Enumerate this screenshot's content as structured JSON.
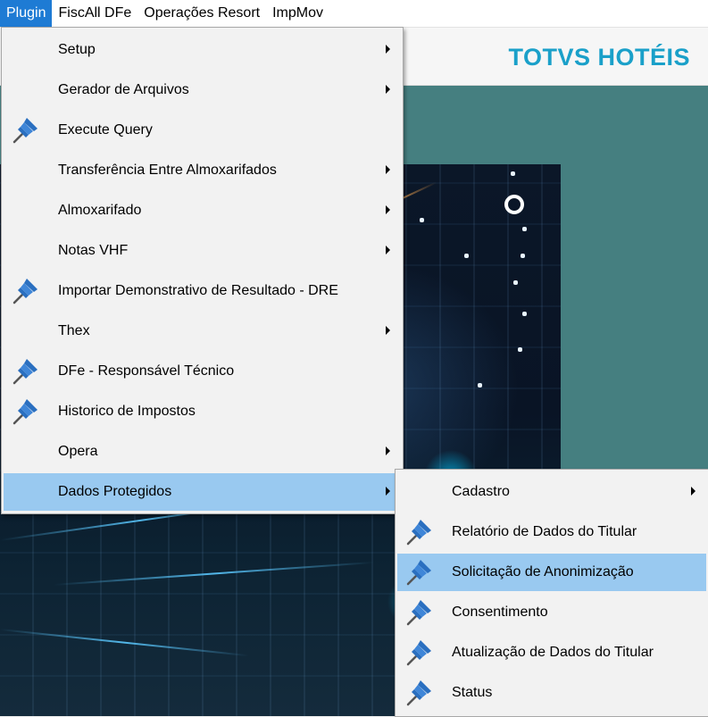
{
  "menubar": {
    "items": [
      {
        "label": "Plugin",
        "active": true
      },
      {
        "label": "FiscAll DFe",
        "active": false
      },
      {
        "label": "Operações Resort",
        "active": false
      },
      {
        "label": "ImpMov",
        "active": false
      }
    ]
  },
  "header": {
    "brand": "TOTVS HOTÉIS"
  },
  "plugin_menu": {
    "items": [
      {
        "label": "Setup",
        "icon": "",
        "submenu": true
      },
      {
        "label": "Gerador de Arquivos",
        "icon": "",
        "submenu": true
      },
      {
        "label": "Execute Query",
        "icon": "pin-icon",
        "submenu": false
      },
      {
        "label": "Transferência Entre Almoxarifados",
        "icon": "",
        "submenu": true
      },
      {
        "label": "Almoxarifado",
        "icon": "",
        "submenu": true
      },
      {
        "label": "Notas VHF",
        "icon": "",
        "submenu": true
      },
      {
        "label": "Importar Demonstrativo de Resultado - DRE",
        "icon": "pin-icon",
        "submenu": false
      },
      {
        "label": "Thex",
        "icon": "",
        "submenu": true
      },
      {
        "label": "DFe - Responsável Técnico",
        "icon": "pin-icon",
        "submenu": false
      },
      {
        "label": "Historico de Impostos",
        "icon": "pin-icon",
        "submenu": false
      },
      {
        "label": "Opera",
        "icon": "",
        "submenu": true
      },
      {
        "label": "Dados Protegidos",
        "icon": "",
        "submenu": true,
        "highlighted": true
      }
    ]
  },
  "dados_protegidos_menu": {
    "items": [
      {
        "label": "Cadastro",
        "icon": "",
        "submenu": true
      },
      {
        "label": "Relatório de Dados do Titular",
        "icon": "pin-icon",
        "submenu": false
      },
      {
        "label": "Solicitação de Anonimização",
        "icon": "pin-icon",
        "submenu": false,
        "highlighted": true
      },
      {
        "label": "Consentimento",
        "icon": "pin-icon",
        "submenu": false
      },
      {
        "label": "Atualização de Dados do Titular",
        "icon": "pin-icon",
        "submenu": false
      },
      {
        "label": "Status",
        "icon": "pin-icon",
        "submenu": false
      }
    ]
  },
  "colors": {
    "menubar_active": "#1e7bd4",
    "menu_highlight": "#99c9f0",
    "brand": "#1aa0c9",
    "background_teal": "#457f80",
    "pin": "#2a6fc0"
  }
}
